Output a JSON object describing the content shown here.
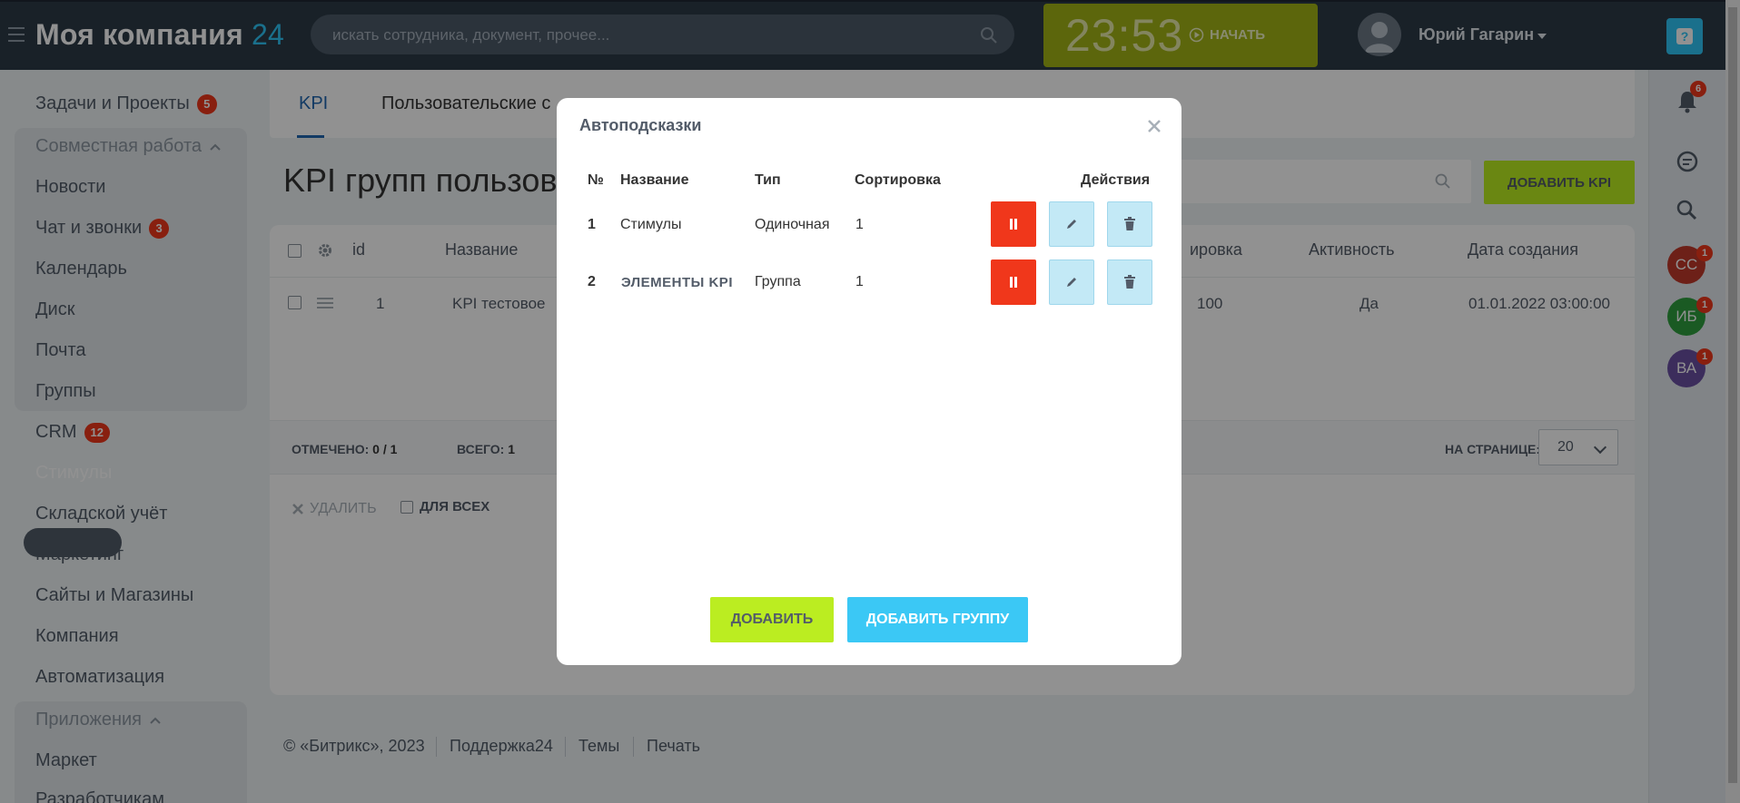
{
  "header": {
    "logo_main": "Моя компания",
    "logo_num": "24",
    "search_placeholder": "искать сотрудника, документ, прочее...",
    "clock_time": "23:53",
    "clock_start": "НАЧАТЬ",
    "user_name": "Юрий Гагарин"
  },
  "menu": {
    "tasks": "Задачи и Проекты",
    "tasks_count": "5",
    "collab_group": "Совместная работа",
    "news": "Новости",
    "chat": "Чат и звонки",
    "chat_count": "3",
    "calendar": "Календарь",
    "disk": "Диск",
    "mail": "Почта",
    "groups": "Группы",
    "crm": "CRM",
    "crm_count": "12",
    "stimuly": "Стимулы",
    "warehouse": "Складской учёт",
    "marketing": "Маркетинг",
    "sites": "Сайты и Магазины",
    "company": "Компания",
    "automation": "Автоматизация",
    "apps_group": "Приложения",
    "market": "Маркет",
    "developers": "Разработчикам"
  },
  "rail": {
    "notif_count": "6",
    "avatars": [
      {
        "initials": "СС",
        "count": "1",
        "color": "#c0392b"
      },
      {
        "initials": "ИБ",
        "count": "1",
        "color": "#2e9e3e"
      },
      {
        "initials": "ВА",
        "count": "1",
        "color": "#6a4fa3"
      }
    ]
  },
  "main": {
    "tab_kpi": "KPI",
    "tab_custom": "Пользовательские с",
    "page_title": "KPI групп пользоват",
    "add_kpi_label": "ДОБАВИТЬ KPI",
    "grid": {
      "headers": [
        "id",
        "Название",
        "ировка",
        "Активность",
        "Дата создания"
      ],
      "row": {
        "id": "1",
        "name": "KPI тестовое",
        "sort": "100",
        "active": "Да",
        "created": "01.01.2022 03:00:00"
      }
    },
    "footer": {
      "marked_label": "ОТМЕЧЕНО:",
      "marked_value": "0 / 1",
      "total_label": "ВСЕГО:",
      "total_value": "1",
      "per_page_label": "НА СТРАНИЦЕ:",
      "per_page_value": "20",
      "delete_label": "УДАЛИТЬ",
      "for_all_label": "ДЛЯ ВСЕХ"
    }
  },
  "page_footer": {
    "copyright": "© «Битрикс», 2023",
    "support": "Поддержка24",
    "themes": "Темы",
    "print": "Печать"
  },
  "modal": {
    "title": "Автоподсказки",
    "columns": {
      "num": "№",
      "name": "Название",
      "type": "Тип",
      "sort": "Сортировка",
      "actions": "Действия"
    },
    "rows": [
      {
        "num": "1",
        "name": "Стимулы",
        "type": "Одиночная",
        "sort": "1"
      },
      {
        "num": "2",
        "name": "ЭЛЕМЕНТЫ KPI",
        "type": "Группа",
        "sort": "1"
      }
    ],
    "add_label": "ДОБАВИТЬ",
    "add_group_label": "ДОБАВИТЬ ГРУППУ"
  }
}
